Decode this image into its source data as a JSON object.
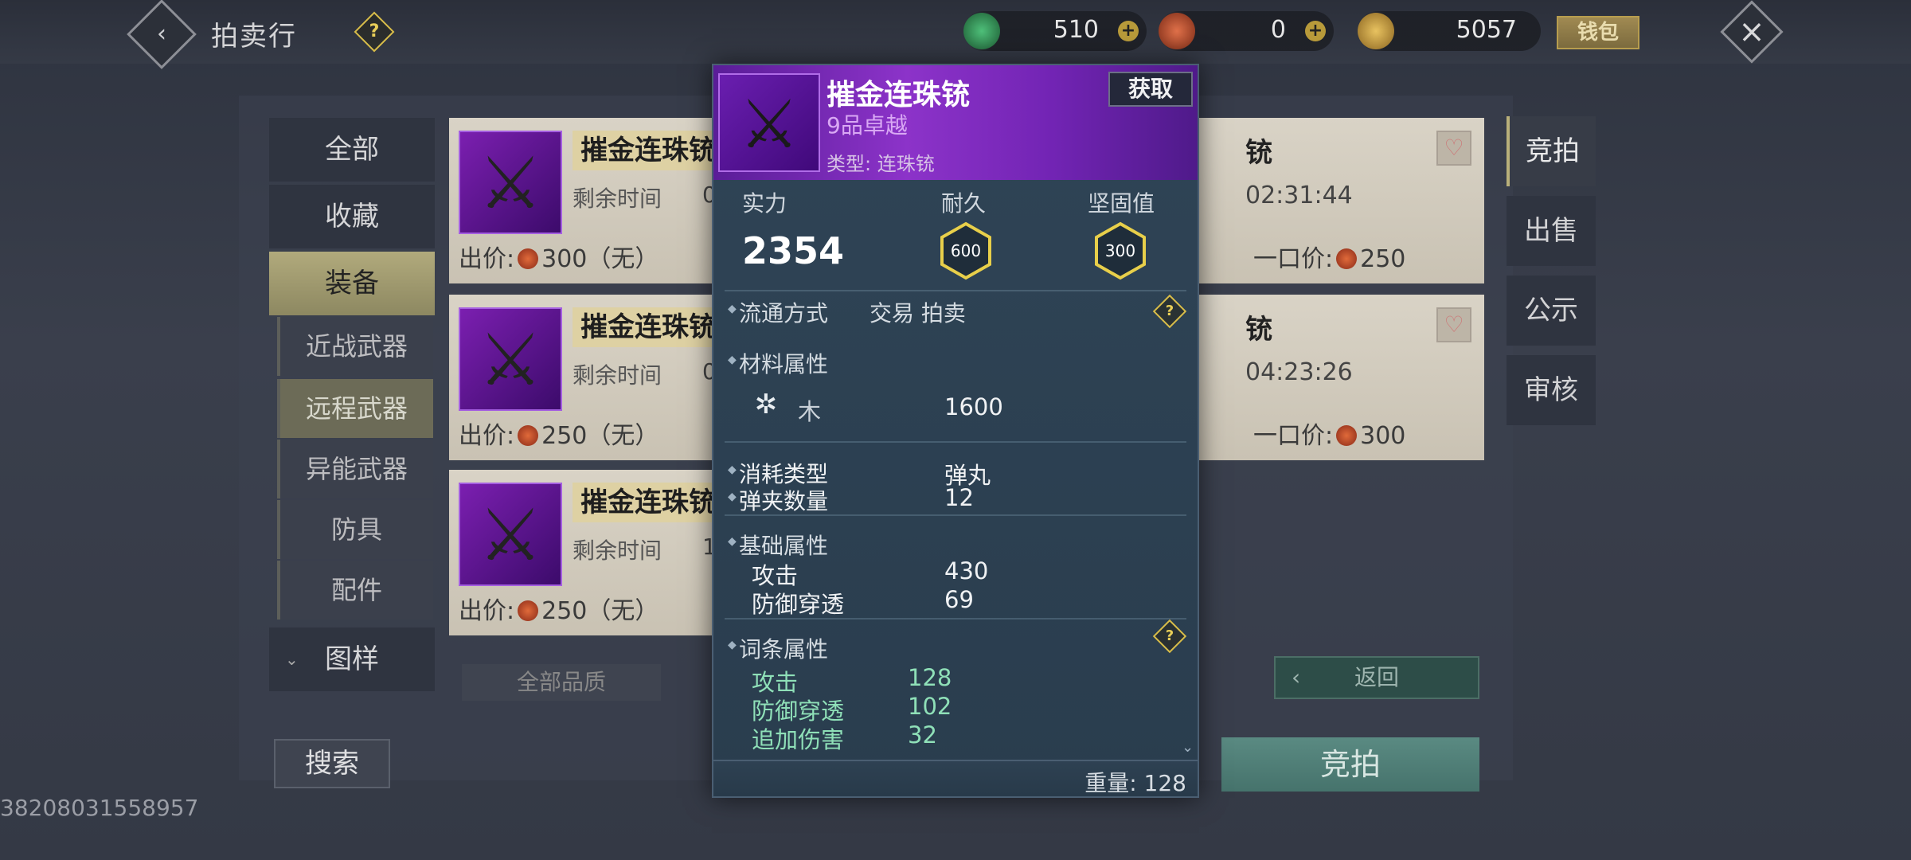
{
  "header": {
    "title": "拍卖行",
    "currencies": [
      {
        "name": "jade-coin",
        "value": "510",
        "color": "#2e8a4a"
      },
      {
        "name": "red-coin",
        "value": "0",
        "color": "#b54a2a"
      },
      {
        "name": "gold-coin",
        "value": "5057",
        "color": "#c9a03c"
      }
    ],
    "wallet_label": "钱包"
  },
  "nav": {
    "items": [
      "全部",
      "收藏",
      "装备"
    ],
    "sub_items": [
      "近战武器",
      "远程武器",
      "异能武器",
      "防具",
      "配件"
    ],
    "pattern": "图样",
    "selected": "装备",
    "selected_sub": "远程武器"
  },
  "listings": [
    {
      "name": "摧金连珠铳",
      "time_label": "剩余时间",
      "time_value": "00",
      "price_label": "出价:",
      "price": "300（无）",
      "right_name": "铳",
      "right_time": "02:31:44",
      "buyout_label": "一口价:",
      "buyout": "250"
    },
    {
      "name": "摧金连珠铳",
      "time_label": "剩余时间",
      "time_value": "03",
      "price_label": "出价:",
      "price": "250（无）",
      "right_name": "铳",
      "right_time": "04:23:26",
      "buyout_label": "一口价:",
      "buyout": "300"
    },
    {
      "name": "摧金连珠铳",
      "time_label": "剩余时间",
      "time_value": "19",
      "price_label": "出价:",
      "price": "250（无）"
    }
  ],
  "right_tabs": [
    "竞拍",
    "出售",
    "公示",
    "审核"
  ],
  "filters": {
    "quality": "全部品质",
    "back": "返回"
  },
  "buttons": {
    "search": "搜索",
    "bid": "竞拍"
  },
  "uid": "38208031558957",
  "tooltip": {
    "name": "摧金连珠铳",
    "grade": "9品卓越",
    "type": "类型: 连珠铳",
    "get": "获取",
    "power_label": "实力",
    "power": "2354",
    "durability_label": "耐久",
    "durability": "600",
    "solidity_label": "坚固值",
    "solidity": "300",
    "circulation_label": "流通方式",
    "circulation": "交易 拍卖",
    "material_label": "材料属性",
    "material_name": "木",
    "material_value": "1600",
    "consume_label": "消耗类型",
    "consume_value": "弹丸",
    "clip_label": "弹夹数量",
    "clip_value": "12",
    "base_label": "基础属性",
    "base": [
      {
        "k": "攻击",
        "v": "430"
      },
      {
        "k": "防御穿透",
        "v": "69"
      }
    ],
    "affix_label": "词条属性",
    "affix": [
      {
        "k": "攻击",
        "v": "128"
      },
      {
        "k": "防御穿透",
        "v": "102"
      },
      {
        "k": "追加伤害",
        "v": "32"
      }
    ],
    "weight": "重量: 128"
  }
}
